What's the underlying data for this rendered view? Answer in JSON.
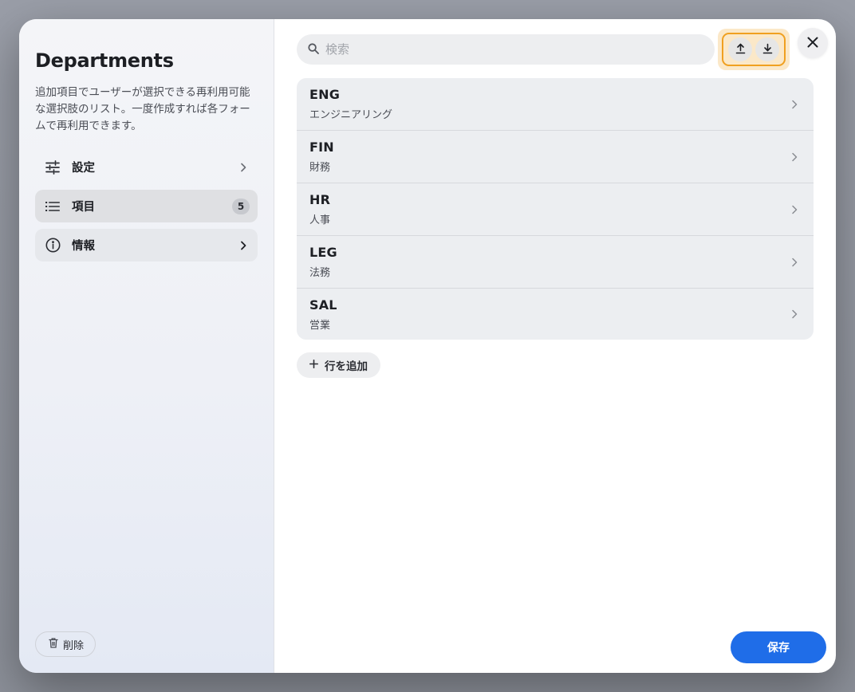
{
  "sidebar": {
    "title": "Departments",
    "description": "追加項目でユーザーが選択できる再利用可能な選択肢のリスト。一度作成すれば各フォームで再利用できます。",
    "nav": [
      {
        "label": "設定",
        "icon": "sliders-icon"
      },
      {
        "label": "項目",
        "icon": "list-icon",
        "badge": "5"
      },
      {
        "label": "情報",
        "icon": "info-icon"
      }
    ],
    "delete_label": "削除"
  },
  "main": {
    "search_placeholder": "検索",
    "items": [
      {
        "code": "ENG",
        "name": "エンジニアリング"
      },
      {
        "code": "FIN",
        "name": "財務"
      },
      {
        "code": "HR",
        "name": "人事"
      },
      {
        "code": "LEG",
        "name": "法務"
      },
      {
        "code": "SAL",
        "name": "営業"
      }
    ],
    "add_row_label": "行を追加",
    "save_label": "保存"
  },
  "colors": {
    "accent": "#1f6de8",
    "highlight": "#f0a020"
  }
}
